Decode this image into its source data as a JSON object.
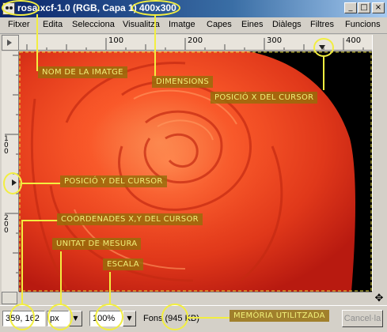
{
  "window": {
    "title": "rosa.xcf-1.0 (RGB, Capa 1) 400x300",
    "minimize": "_",
    "maximize": "□",
    "close": "×"
  },
  "menu": [
    "Fitxer",
    "Edita",
    "Selecciona",
    "Visualitza",
    "Imatge",
    "Capes",
    "Eines",
    "Diàlegs",
    "Filtres",
    "Funcions"
  ],
  "ruler_top": [
    "100",
    "200",
    "300",
    "400"
  ],
  "ruler_left": [
    "100",
    "200"
  ],
  "status": {
    "coords": "359, 162",
    "unit": "px",
    "zoom": "100%",
    "message": "Fons (945 KB)",
    "cancel": "Cancel·la"
  },
  "annotations": {
    "image_name": "NOM DE LA IMATGE",
    "dimensions": "DIMENSIONS",
    "cursor_x": "POSICIÓ X DEL CURSOR",
    "cursor_y": "POSICIÓ Y DEL CURSOR",
    "cursor_xy": "COORDENADES X,Y DEL CURSOR",
    "unit": "UNITAT DE MESURA",
    "scale": "ESCALA",
    "memory": "MEMÒRIA UTILITZADA"
  },
  "colors": {
    "highlight": "#f2ee40",
    "titlebar": "#0a246a",
    "rose": "#f04a20"
  }
}
